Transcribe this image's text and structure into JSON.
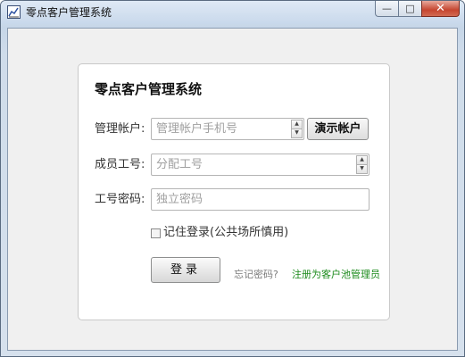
{
  "window": {
    "title": "零点客户管理系统",
    "minimize_glyph": "—",
    "maximize_glyph": "□",
    "close_glyph": "✕"
  },
  "form": {
    "heading": "零点客户管理系统",
    "admin_account": {
      "label": "管理帐户:",
      "value": "",
      "placeholder": "管理帐户手机号"
    },
    "demo_button": "演示帐户",
    "member_id": {
      "label": "成员工号:",
      "value": "",
      "placeholder": "分配工号"
    },
    "password": {
      "label": "工号密码:",
      "value": "",
      "placeholder": "独立密码"
    },
    "remember": {
      "label": "记住登录(公共场所慎用)",
      "checked": false
    },
    "login_button": "登录",
    "forgot_link": "忘记密码?",
    "register_link": "注册为客户池管理员"
  },
  "icons": {
    "app": "chart-line-icon",
    "spin_up": "▲",
    "spin_down": "▼"
  },
  "colors": {
    "register_link": "#1c8b1c",
    "forgot_link": "#7a7a7a",
    "close_button": "#c5452f"
  }
}
